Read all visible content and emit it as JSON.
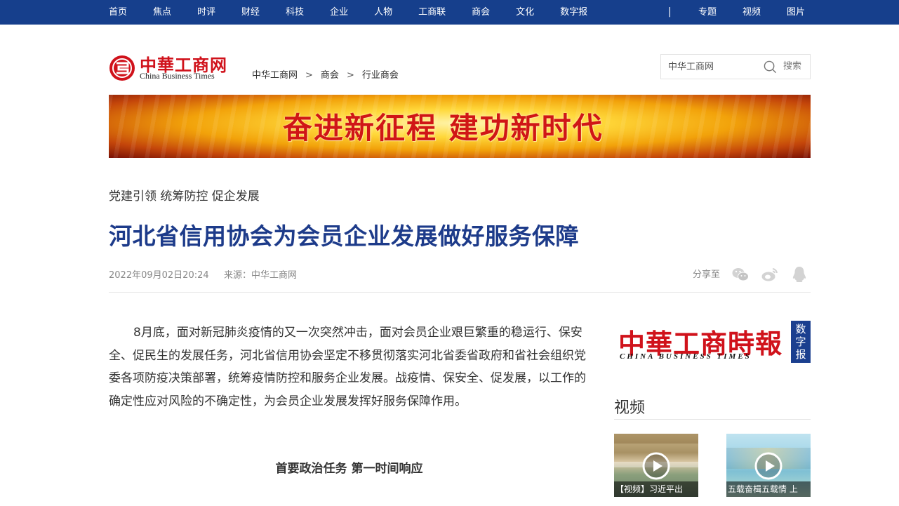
{
  "nav": {
    "left": [
      "首页",
      "焦点",
      "时评",
      "财经",
      "科技",
      "企业",
      "人物",
      "工商联",
      "商会",
      "文化",
      "数字报"
    ],
    "separator": "|",
    "right": [
      "专题",
      "视频",
      "图片"
    ]
  },
  "logo": {
    "cn": "中華工商网",
    "en": "China Business Times"
  },
  "breadcrumb": {
    "items": [
      "中华工商网",
      "商会",
      "行业商会"
    ],
    "separator": ">"
  },
  "search": {
    "placeholder": "中华工商网",
    "button_label": "搜索"
  },
  "banner": {
    "text": "奋进新征程  建功新时代"
  },
  "article": {
    "kicker": "党建引领 统筹防控 促企发展",
    "title": "河北省信用协会为会员企业发展做好服务保障",
    "date": "2022年09月02日20:24",
    "source": "来源：中华工商网",
    "share_label": "分享至",
    "share_icons": [
      "wechat-icon",
      "weibo-icon",
      "qq-icon"
    ],
    "paragraph1": "8月底，面对新冠肺炎疫情的又一次突然冲击，面对会员企业艰巨繁重的稳运行、保安全、促民生的发展任务，河北省信用协会坚定不移贯彻落实河北省委省政府和省社会组织党委各项防疫决策部署，统筹疫情防控和服务企业发展。战疫情、保安全、促发展，以工作的确定性应对风险的不确定性，为会员企业发展发挥好服务保障作用。",
    "subhead": "首要政治任务 第一时间响应"
  },
  "sidebar": {
    "paper_cn": "中華工商時報",
    "paper_en": "CHINA BUSINESS TIMES",
    "paper_tag": "数字报",
    "video_title": "视频",
    "videos": [
      {
        "caption": "【视频】习近平出"
      },
      {
        "caption": "五载奋楫五载情 上"
      }
    ]
  },
  "colors": {
    "nav_bg": "#163f8c",
    "title_blue": "#1d3b8a",
    "brand_red": "#d0121b"
  }
}
